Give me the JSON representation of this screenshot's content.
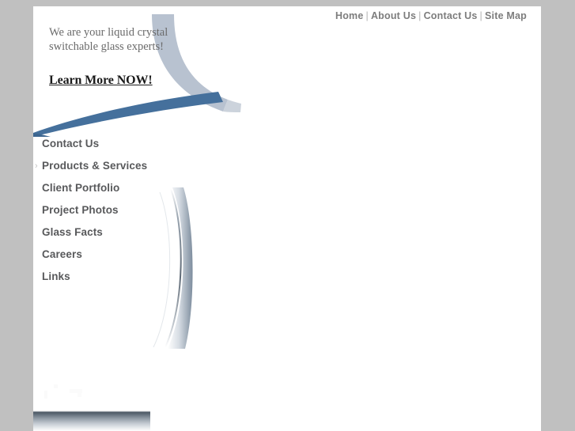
{
  "topnav": {
    "items": [
      {
        "label": "Home"
      },
      {
        "label": "About Us"
      },
      {
        "label": "Contact Us"
      },
      {
        "label": "Site Map"
      }
    ],
    "separator": "|"
  },
  "banner": {
    "tagline": "We are your liquid crystal switchable glass experts!",
    "cta_label": "Learn More NOW!",
    "swoosh_color": "#45709c",
    "arc_color": "#b8c2d0"
  },
  "sidebar": {
    "items": [
      {
        "label": "Contact Us",
        "marker": ""
      },
      {
        "label": "Products & Services",
        "marker": "›"
      },
      {
        "label": "Client Portfolio",
        "marker": ""
      },
      {
        "label": "Project Photos",
        "marker": ""
      },
      {
        "label": "Glass Facts",
        "marker": ""
      },
      {
        "label": "Careers",
        "marker": ""
      },
      {
        "label": "Links",
        "marker": ""
      }
    ]
  },
  "colors": {
    "page_background": "#c0c0c0",
    "panel": "#ffffff",
    "nav_text": "#7d7d7d",
    "sidebar_text": "#58595b",
    "tagline_text": "#6b6b6b"
  }
}
